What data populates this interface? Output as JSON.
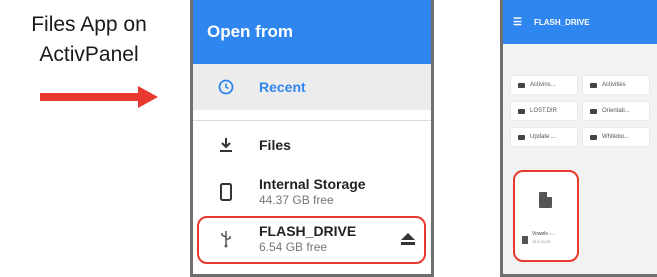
{
  "caption": {
    "line1": "Files App on",
    "line2": "ActivPanel"
  },
  "colors": {
    "accent": "#2f86ef",
    "highlight": "#e8392e",
    "arrow": "#e8392e"
  },
  "left_panel": {
    "title": "Open from",
    "recent": {
      "icon": "clock-icon",
      "label": "Recent"
    },
    "files": {
      "icon": "download-icon",
      "label": "Files"
    },
    "internal": {
      "icon": "phone-icon",
      "label": "Internal Storage",
      "free": "44.37 GB free"
    },
    "flash": {
      "icon": "usb-icon",
      "label": "FLASH_DRIVE",
      "free": "6.54 GB free",
      "eject_icon": "eject-icon"
    }
  },
  "right_panel": {
    "menu_icon": "menu-icon",
    "title": "FLASH_DRIVE",
    "folders": [
      "Activins...",
      "Activities",
      "LOST.DIR",
      "Orientati...",
      "Update ...",
      "Whitebo..."
    ],
    "file": {
      "icon": "document-icon",
      "name": "Vowels -...",
      "date": "13 8 11:20"
    }
  }
}
